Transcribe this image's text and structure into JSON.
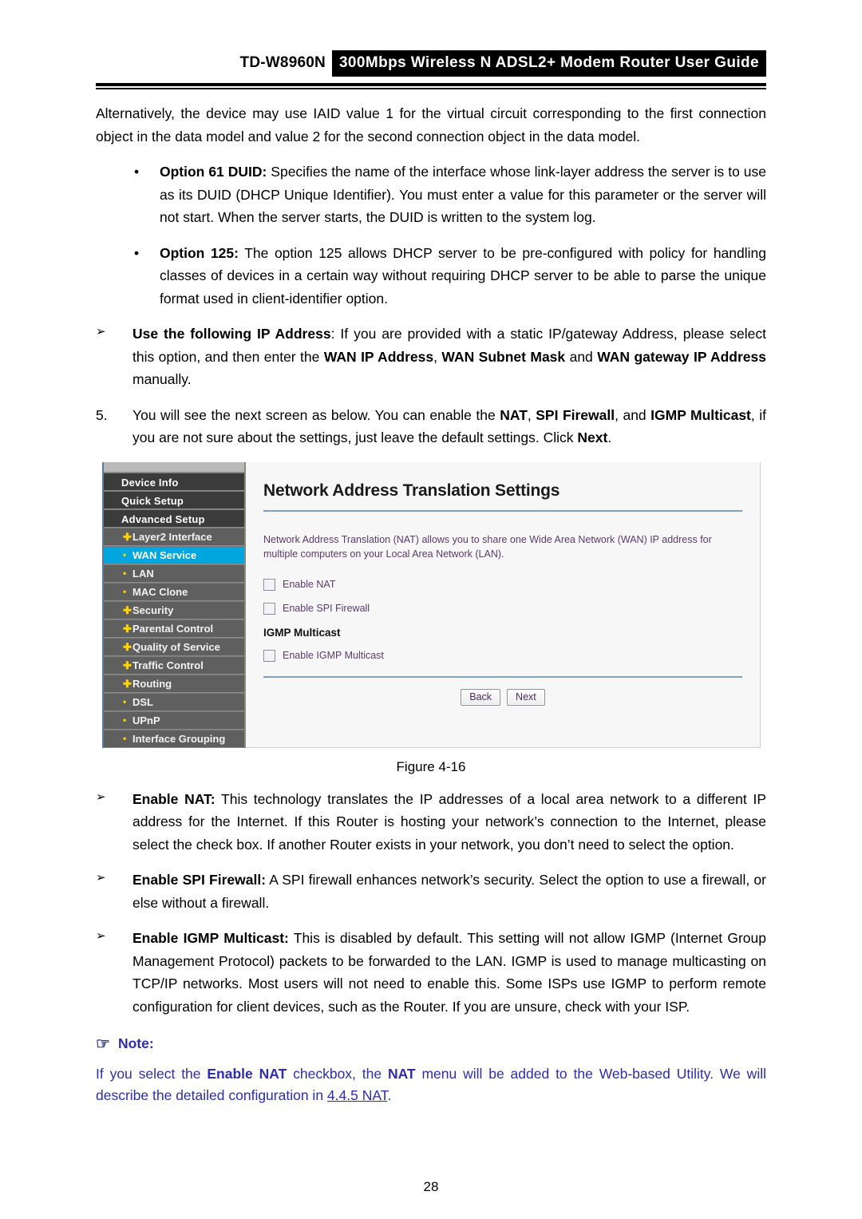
{
  "header": {
    "model": "TD-W8960N",
    "title": "300Mbps Wireless N ADSL2+ Modem Router User Guide"
  },
  "content": {
    "intro_paragraph": "Alternatively, the device may use IAID value 1 for the virtual circuit corresponding to the first connection object in the data model and value 2 for the second connection object in the data model.",
    "bullets": [
      {
        "marker": "•",
        "term": "Option 61 DUID:",
        "text": " Specifies the name of the interface whose link-layer address the server is to use as its DUID (DHCP Unique Identifier). You must enter a value for this parameter or the server will not start. When the server starts, the DUID is written to the system log."
      },
      {
        "marker": "•",
        "term": "Option 125:",
        "text": " The option 125 allows DHCP server to be pre-configured with policy for handling classes of devices in a certain way without requiring DHCP server to be able to parse the unique format used in client-identifier option."
      }
    ],
    "use_following_ip": {
      "marker": "➢",
      "term": "Use the following IP Address",
      "text_1": ": If you are provided with a static IP/gateway Address, please select this option, and then enter the ",
      "bold_1": "WAN IP Address",
      "text_2": ", ",
      "bold_2": "WAN Subnet Mask",
      "text_3": " and ",
      "bold_3": "WAN gateway IP Address",
      "text_4": " manually."
    },
    "step5": {
      "marker": "5.",
      "text_1": "You will see the next screen as below. You can enable the ",
      "bold_1": "NAT",
      "text_2": ", ",
      "bold_2": "SPI Firewall",
      "text_3": ", and ",
      "bold_3": "IGMP Multicast",
      "text_4": ", if you are not sure about the settings, just leave the default settings. Click ",
      "bold_4": "Next",
      "text_5": "."
    },
    "figure_caption": "Figure 4-16",
    "definitions": [
      {
        "marker": "➢",
        "term": "Enable NAT:",
        "text": " This technology translates the IP addresses of a local area network to a different IP address for the Internet. If this Router is hosting your network’s connection to the Internet, please select the check box. If another Router exists in your network, you don’t need to select the option."
      },
      {
        "marker": "➢",
        "term": "Enable SPI Firewall:",
        "text": " A SPI firewall enhances network’s security. Select the option to use a firewall, or else without a firewall."
      },
      {
        "marker": "➢",
        "term": "Enable IGMP Multicast:",
        "text": " This is disabled by default. This setting will not allow IGMP (Internet Group Management Protocol) packets to be forwarded to the LAN. IGMP is used to manage multicasting on TCP/IP networks. Most users will not need to enable this. Some ISPs use IGMP to perform remote configuration for client devices, such as the Router. If you are unsure, check with your ISP."
      }
    ]
  },
  "note": {
    "icon": "pointing-hand-icon",
    "icon_glyph": "☞",
    "heading": "Note:",
    "text_1": "If you select the ",
    "bold_1": "Enable NAT",
    "text_2": " checkbox, the ",
    "bold_2": "NAT",
    "text_3": " menu will be added to the Web-based Utility. We will describe the detailed configuration in ",
    "link": "4.4.5 NAT",
    "text_4": "."
  },
  "screenshot": {
    "sidebar": {
      "top_items": [
        {
          "label": "Device Info"
        },
        {
          "label": "Quick Setup"
        },
        {
          "label": "Advanced Setup"
        }
      ],
      "sub_items": [
        {
          "label": "Layer2 Interface",
          "icon": "plus-icon",
          "glyph": "✚",
          "active": false
        },
        {
          "label": "WAN Service",
          "icon": "dot-icon",
          "glyph": "•",
          "active": true
        },
        {
          "label": "LAN",
          "icon": "dot-icon",
          "glyph": "•",
          "active": false
        },
        {
          "label": "MAC Clone",
          "icon": "dot-icon",
          "glyph": "•",
          "active": false
        },
        {
          "label": "Security",
          "icon": "plus-icon",
          "glyph": "✚",
          "active": false
        },
        {
          "label": "Parental Control",
          "icon": "plus-icon",
          "glyph": "✚",
          "active": false
        },
        {
          "label": "Quality of Service",
          "icon": "plus-icon",
          "glyph": "✚",
          "active": false
        },
        {
          "label": "Traffic Control",
          "icon": "plus-icon",
          "glyph": "✚",
          "active": false
        },
        {
          "label": "Routing",
          "icon": "plus-icon",
          "glyph": "✚",
          "active": false
        },
        {
          "label": "DSL",
          "icon": "dot-icon",
          "glyph": "•",
          "active": false
        },
        {
          "label": "UPnP",
          "icon": "dot-icon",
          "glyph": "•",
          "active": false
        },
        {
          "label": "Interface Grouping",
          "icon": "dot-icon",
          "glyph": "•",
          "active": false
        }
      ],
      "active_color": "#00a6dd",
      "icon_color": "#ffd400"
    },
    "panel": {
      "title": "Network Address Translation Settings",
      "description": "Network Address Translation (NAT) allows you to share one Wide Area Network (WAN) IP address for multiple computers on your Local Area Network (LAN).",
      "checkboxes": [
        {
          "label": "Enable NAT",
          "checked": false
        },
        {
          "label": "Enable SPI Firewall",
          "checked": false
        }
      ],
      "section_heading": "IGMP Multicast",
      "igmp_checkbox": {
        "label": "Enable IGMP Multicast",
        "checked": false
      },
      "buttons": [
        {
          "label": "Back"
        },
        {
          "label": "Next"
        }
      ]
    }
  },
  "footer": {
    "page_number": "28"
  }
}
